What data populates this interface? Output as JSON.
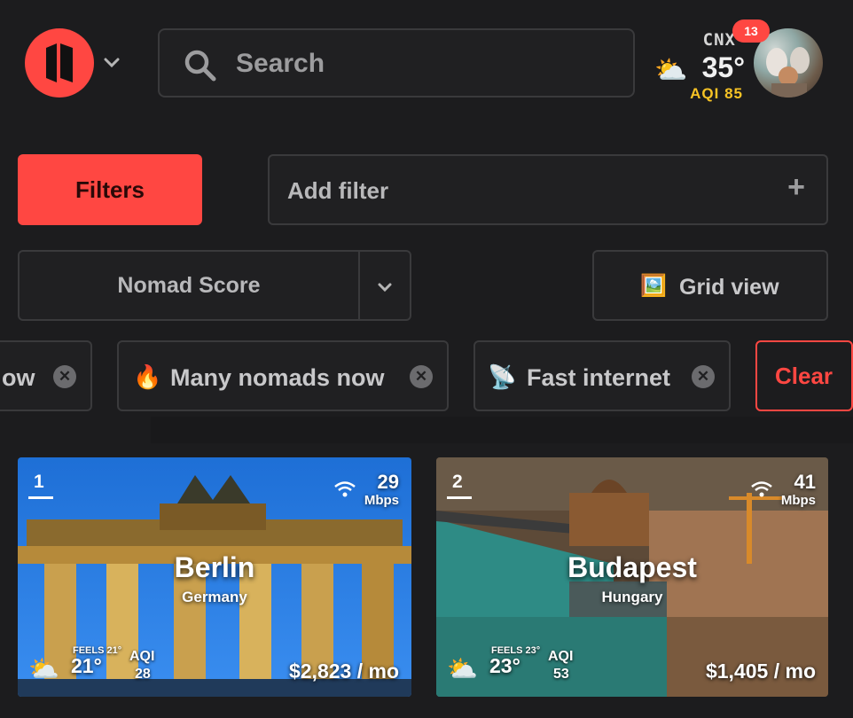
{
  "header": {
    "search_placeholder": "Search",
    "location": {
      "code": "CNX",
      "temperature": "35°",
      "aqi_label": "AQI",
      "aqi_value": "85",
      "weather_icon": "sun-cloud-icon"
    },
    "notifications_count": "13"
  },
  "toolbar": {
    "filters_label": "Filters",
    "add_filter_label": "Add filter",
    "add_filter_icon": "+",
    "sort_label": "Nomad Score",
    "view_label": "Grid view",
    "view_icon": "🖼️"
  },
  "chips": [
    {
      "label": "ow",
      "icon": ""
    },
    {
      "label": "Many nomads now",
      "icon": "🔥"
    },
    {
      "label": "Fast internet",
      "icon": "📡"
    }
  ],
  "clear_label": "Clear",
  "colors": {
    "accent": "#ff4742",
    "aqi": "#f7c325",
    "background": "#1c1c1e"
  },
  "cards": [
    {
      "rank": "1",
      "city": "Berlin",
      "country": "Germany",
      "speed": "29",
      "speed_unit": "Mbps",
      "feels": "FEELS 21°",
      "temp": "21°",
      "aqi_label": "AQI",
      "aqi": "28",
      "price": "$2,823 / mo",
      "weather_icon": "cloud-sun-icon"
    },
    {
      "rank": "2",
      "city": "Budapest",
      "country": "Hungary",
      "speed": "41",
      "speed_unit": "Mbps",
      "feels": "FEELS 23°",
      "temp": "23°",
      "aqi_label": "AQI",
      "aqi": "53",
      "price": "$1,405 / mo",
      "weather_icon": "cloud-sun-icon"
    }
  ]
}
